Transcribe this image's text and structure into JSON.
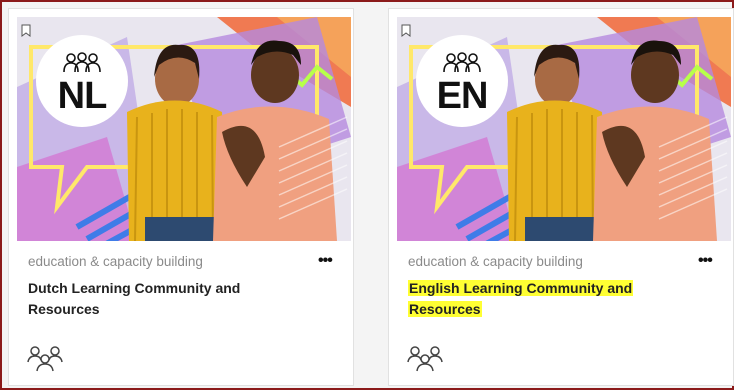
{
  "colors": {
    "highlight": "#ffff33",
    "frame_border": "#8b1a1a",
    "category_text": "#8a8a8a",
    "title_text": "#222222"
  },
  "cards": [
    {
      "language_code": "NL",
      "category": "education & capacity building",
      "title": "Dutch Learning Community and Resources",
      "more_label": "•••",
      "icons": [
        "bookmark-icon",
        "people-icon",
        "more-options-icon",
        "community-icon"
      ]
    },
    {
      "language_code": "EN",
      "category": "education & capacity building",
      "title": "English Learning Community and Resources",
      "title_highlighted": true,
      "more_label": "•••",
      "icons": [
        "bookmark-icon",
        "people-icon",
        "more-options-icon",
        "community-icon"
      ]
    }
  ]
}
